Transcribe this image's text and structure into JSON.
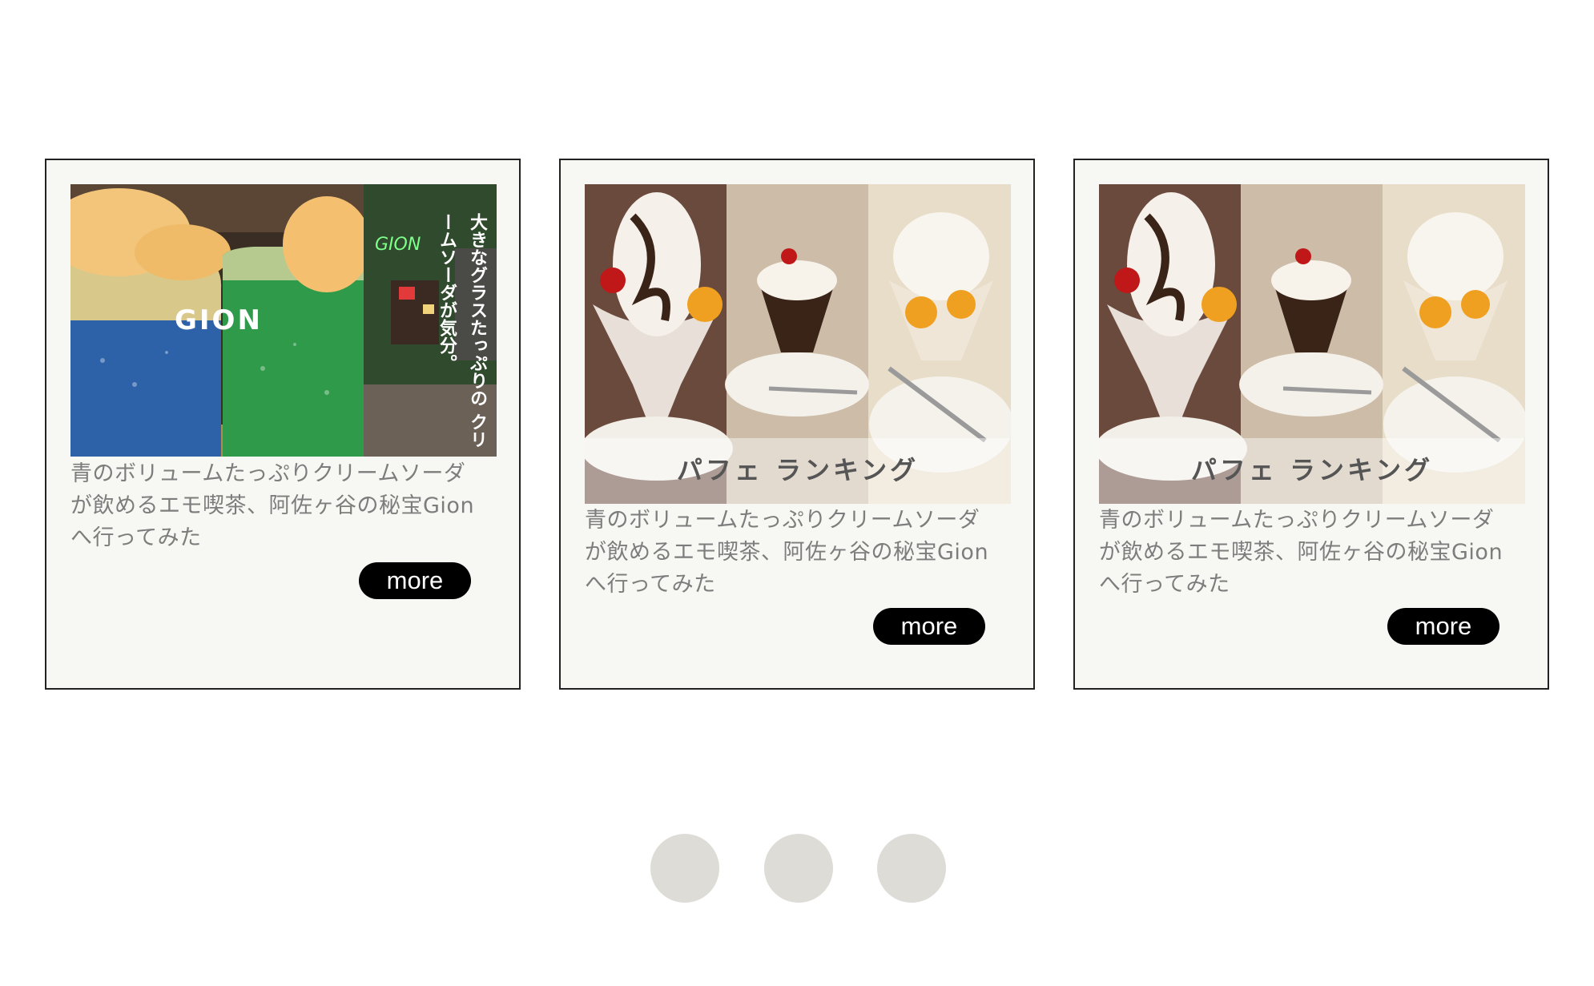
{
  "cards": [
    {
      "image_overlay_title": "GION",
      "image_overlay_vertical": "大きなグラスたっぷりの クリームソーダが気分。",
      "image_sign_text": "GION",
      "text": "青のボリュームたっぷりクリームソーダが飲めるエモ喫茶、阿佐ヶ谷の秘宝Gionへ行ってみた",
      "more_label": "more"
    },
    {
      "image_banner": "パフェ ランキング",
      "text": "青のボリュームたっぷりクリームソーダが飲めるエモ喫茶、阿佐ヶ谷の秘宝Gionへ行ってみた",
      "more_label": "more"
    },
    {
      "image_banner": "パフェ ランキング",
      "text": "青のボリュームたっぷりクリームソーダが飲めるエモ喫茶、阿佐ヶ谷の秘宝Gionへ行ってみた",
      "more_label": "more"
    }
  ],
  "pagination": {
    "count": 3
  },
  "colors": {
    "card_bg": "#f7f7f3",
    "card_border": "#222222",
    "text": "#7d7d7d",
    "button_bg": "#000000",
    "dot": "#dddcd6"
  }
}
